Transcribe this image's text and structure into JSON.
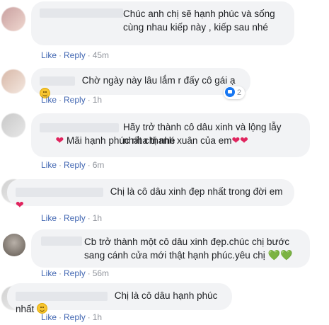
{
  "comments": [
    {
      "text": "Chúc anh chị sẽ hạnh phúc và sống cùng nhau kiếp này , kiếp sau nhé",
      "like": "Like",
      "reply": "Reply",
      "time": "45m",
      "avatar_colors": [
        "#c9a0a0",
        "#e8c8c0"
      ]
    },
    {
      "text": "Chờ ngày này lâu lắm r đấy cô gái ạ",
      "like": "Like",
      "reply": "Reply",
      "time": "1h",
      "reaction_count": "2",
      "avatar_colors": [
        "#d8b8a8",
        "#f0e0d8"
      ]
    },
    {
      "text": "Hãy trở thành cô dâu xinh và lộng lẫy nhất chị nhé",
      "text2": "Mãi hạnh phúc nha thanh xuân của em",
      "like": "Like",
      "reply": "Reply",
      "time": "6m",
      "avatar_colors": [
        "#c8c8c8",
        "#e0e0e0"
      ]
    },
    {
      "text": "Chị là cô dâu xinh đẹp nhất trong đời em",
      "like": "Like",
      "reply": "Reply",
      "time": "1h",
      "avatar_colors": [
        "#d0d0d0",
        "#ebebeb"
      ]
    },
    {
      "text": "Cb trở thành một cô dâu xinh đẹp.chúc chị bước sang cánh cửa mới thật hạnh phúc.yêu chị",
      "like": "Like",
      "reply": "Reply",
      "time": "56m",
      "avatar_colors": [
        "#706860",
        "#a09890"
      ]
    },
    {
      "text": "Chị là cô dâu hạnh phúc nhất",
      "like": "Like",
      "reply": "Reply",
      "time": "1h",
      "avatar_colors": [
        "#d0d0d0",
        "#ebebeb"
      ]
    }
  ],
  "colors": {
    "link": "#4267b2",
    "meta": "#90949c",
    "bubble": "#f2f3f5",
    "heart": "#e0245e",
    "green_heart": "#4caf24"
  }
}
